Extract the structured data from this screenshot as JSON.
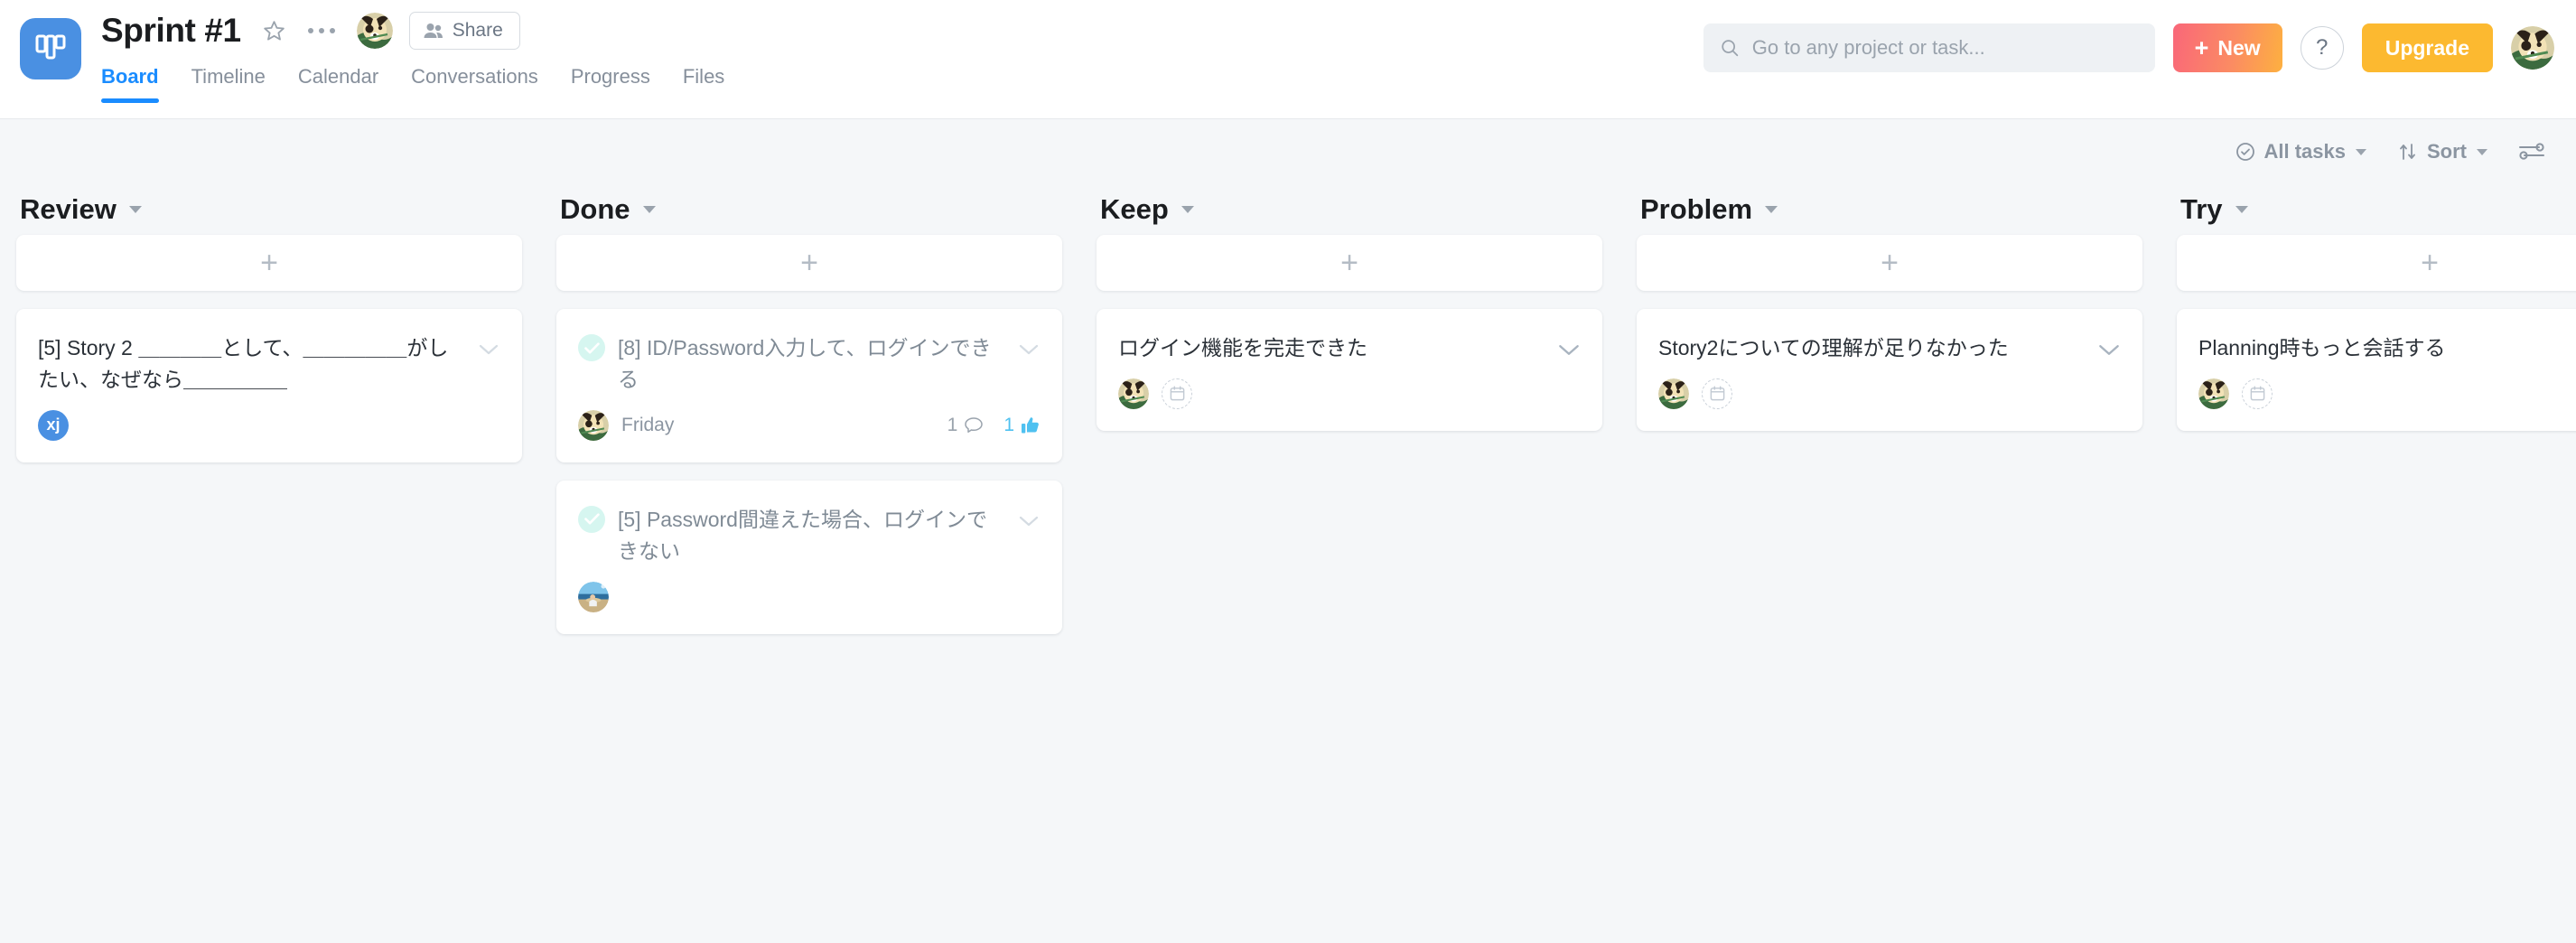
{
  "app": {
    "logo_icon": "kanban-board-icon",
    "brand_color": "#4a90e2"
  },
  "header": {
    "project_title": "Sprint #1",
    "star_icon": "star-outline-icon",
    "more_icon": "ellipsis-icon",
    "owner_avatar_icon": "dog-avatar",
    "share_label": "Share",
    "share_icon": "people-icon",
    "tabs": [
      {
        "label": "Board",
        "active": true
      },
      {
        "label": "Timeline",
        "active": false
      },
      {
        "label": "Calendar",
        "active": false
      },
      {
        "label": "Conversations",
        "active": false
      },
      {
        "label": "Progress",
        "active": false
      },
      {
        "label": "Files",
        "active": false
      }
    ],
    "active_tab_color": "#1a8cff",
    "search": {
      "placeholder": "Go to any project or task...",
      "value": "",
      "icon": "search-icon"
    },
    "new_button": {
      "label": "New",
      "plus": "+",
      "color_start": "#f96779",
      "color_end": "#fdb040"
    },
    "help_button": {
      "label": "?"
    },
    "upgrade_button": {
      "label": "Upgrade",
      "color": "#fcb930"
    },
    "user_avatar_icon": "dog-avatar"
  },
  "toolbar": {
    "filter": {
      "label": "All tasks",
      "icon": "check-circle-icon",
      "chevron": "chevron-down-icon"
    },
    "sort": {
      "label": "Sort",
      "icon": "sort-arrows-icon",
      "chevron": "chevron-down-icon"
    },
    "settings": {
      "icon": "sliders-icon"
    }
  },
  "board": {
    "add_icon": "plus-icon",
    "columns": [
      {
        "title": "Review",
        "chevron": "chevron-down-icon",
        "cards": [
          {
            "title": "[5] Story 2 ＿＿＿＿として、＿＿＿＿＿がしたい、なぜなら＿＿＿＿＿",
            "has_check": false,
            "muted": false,
            "chevron": "chevron-down-icon",
            "assignee": {
              "type": "initials",
              "initials": "xj",
              "color": "#4a90e2"
            },
            "due": null,
            "due_placeholder": false,
            "comments": null,
            "likes": null
          }
        ]
      },
      {
        "title": "Done",
        "chevron": "chevron-down-icon",
        "cards": [
          {
            "title": "[8] ID/Password入力して、ログインできる",
            "has_check": true,
            "muted": true,
            "chevron": "chevron-down-icon",
            "assignee": {
              "type": "image",
              "icon": "dog-avatar"
            },
            "due": "Friday",
            "due_placeholder": false,
            "comments": "1",
            "likes": "1"
          },
          {
            "title": "[5] Password間違えた場合、ログインできない",
            "has_check": true,
            "muted": true,
            "chevron": "chevron-down-icon",
            "assignee": {
              "type": "image",
              "icon": "beach-photo-avatar"
            },
            "due": null,
            "due_placeholder": false,
            "comments": null,
            "likes": null
          }
        ]
      },
      {
        "title": "Keep",
        "chevron": "chevron-down-icon",
        "cards": [
          {
            "title": "ログイン機能を完走できた",
            "has_check": false,
            "muted": false,
            "chevron": "chevron-down-icon",
            "assignee": {
              "type": "image",
              "icon": "dog-avatar"
            },
            "due": null,
            "due_placeholder": true,
            "comments": null,
            "likes": null
          }
        ]
      },
      {
        "title": "Problem",
        "chevron": "chevron-down-icon",
        "cards": [
          {
            "title": "Story2についての理解が足りなかった",
            "has_check": false,
            "muted": false,
            "chevron": "chevron-down-icon",
            "assignee": {
              "type": "image",
              "icon": "dog-avatar"
            },
            "due": null,
            "due_placeholder": true,
            "comments": null,
            "likes": null
          }
        ]
      },
      {
        "title": "Try",
        "chevron": "chevron-down-icon",
        "cards": [
          {
            "title": "Planning時もっと会話する",
            "has_check": false,
            "muted": false,
            "chevron": "chevron-down-icon",
            "assignee": {
              "type": "image",
              "icon": "dog-avatar"
            },
            "due": null,
            "due_placeholder": true,
            "comments": null,
            "likes": null
          }
        ]
      }
    ]
  }
}
